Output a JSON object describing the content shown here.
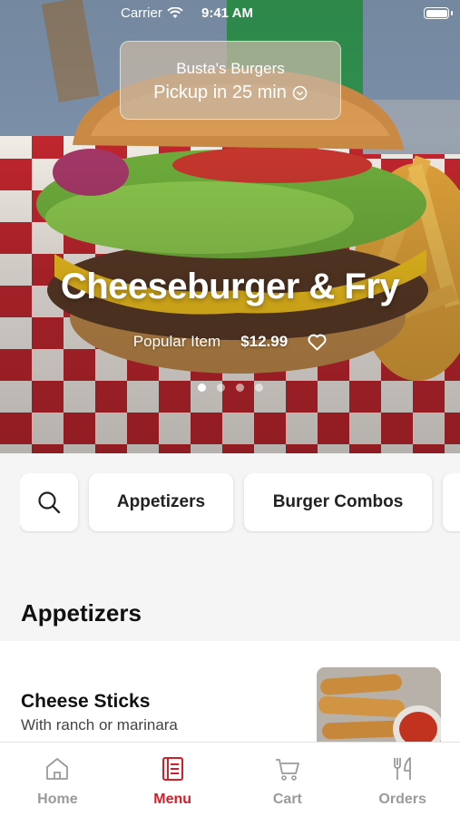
{
  "status_bar": {
    "carrier": "Carrier",
    "time": "9:41 AM"
  },
  "pickup": {
    "store": "Busta's Burgers",
    "time_text": "Pickup in 25 min"
  },
  "hero": {
    "title": "Cheeseburger & Fry",
    "badge": "Popular Item",
    "price": "$12.99",
    "carousel_pages": 4,
    "carousel_active_index": 0
  },
  "categories": [
    "Appetizers",
    "Burger Combos"
  ],
  "section": {
    "title": "Appetizers"
  },
  "item": {
    "name": "Cheese Sticks",
    "description": "With ranch or marinara"
  },
  "tabs": [
    {
      "label": "Home",
      "icon": "home-icon"
    },
    {
      "label": "Menu",
      "icon": "menu-icon"
    },
    {
      "label": "Cart",
      "icon": "cart-icon"
    },
    {
      "label": "Orders",
      "icon": "utensils-icon"
    }
  ],
  "active_tab": "Menu",
  "colors": {
    "accent": "#d0202a",
    "inactive": "#9a9a9a"
  }
}
